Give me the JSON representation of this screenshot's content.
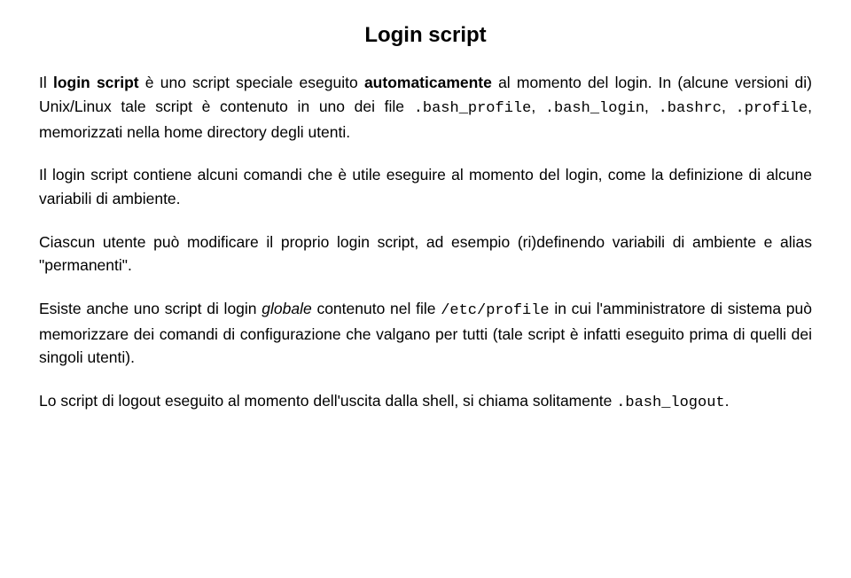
{
  "title": "Login script",
  "p1": {
    "t1": "Il ",
    "t2": "login script",
    "t3": " è uno script speciale eseguito ",
    "t4": "automaticamente",
    "t5": " al momento del login. In (alcune versioni di) Unix/Linux tale script è contenuto in uno dei file ",
    "t6": ".bash_profile",
    "t7": ", ",
    "t8": ".bash_login",
    "t9": ", ",
    "t10": ".bashrc",
    "t11": ", ",
    "t12": ".profile",
    "t13": ", memorizzati nella home directory degli utenti."
  },
  "p2": {
    "t1": "Il login script contiene alcuni comandi che è utile eseguire al momento del login, come la definizione di alcune variabili di ambiente."
  },
  "p3": {
    "t1": "Ciascun utente può modificare il proprio login script, ad esempio (ri)definendo variabili di ambiente e alias \"permanenti\"."
  },
  "p4": {
    "t1": "Esiste anche uno script di login ",
    "t2": "globale",
    "t3": " contenuto nel file ",
    "t4": "/etc/profile",
    "t5": " in cui l'amministratore di sistema può memorizzare dei comandi di configurazione che valgano per tutti (tale script è infatti eseguito prima di quelli dei singoli utenti)."
  },
  "p5": {
    "t1": "Lo script di logout eseguito al momento dell'uscita dalla shell, si chiama solitamente ",
    "t2": ".bash_logout",
    "t3": "."
  }
}
